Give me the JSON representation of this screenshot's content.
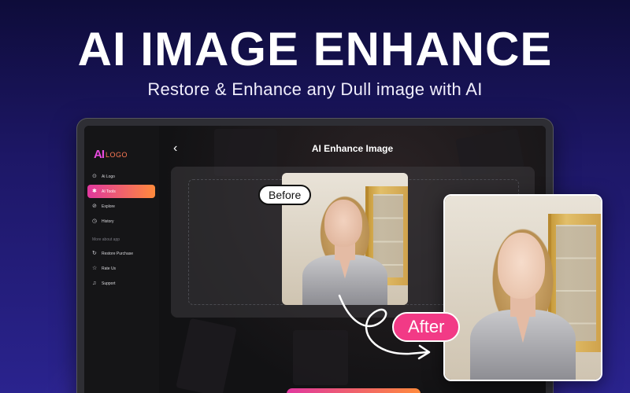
{
  "headline": "AI IMAGE ENHANCE",
  "subheadline": "Restore & Enhance any Dull image with AI",
  "app": {
    "logo_mark": "AI",
    "logo_text": "LOGO",
    "title": "AI Enhance Image",
    "sidebar": {
      "items": [
        {
          "label": "Ai Logo",
          "icon": "ai-logo-icon"
        },
        {
          "label": "AI Tools",
          "icon": "ai-tools-icon",
          "active": true
        },
        {
          "label": "Explore",
          "icon": "compass-icon"
        },
        {
          "label": "History",
          "icon": "clock-icon"
        }
      ],
      "section_label": "More about app",
      "more_items": [
        {
          "label": "Restore Purchase",
          "icon": "restore-icon"
        },
        {
          "label": "Rate Us",
          "icon": "star-icon"
        },
        {
          "label": "Support",
          "icon": "headset-icon"
        }
      ]
    }
  },
  "labels": {
    "before": "Before",
    "after": "After"
  },
  "colors": {
    "accent_pink": "#f23a86",
    "accent_orange": "#ff8a3c",
    "background": "#1d1766"
  }
}
